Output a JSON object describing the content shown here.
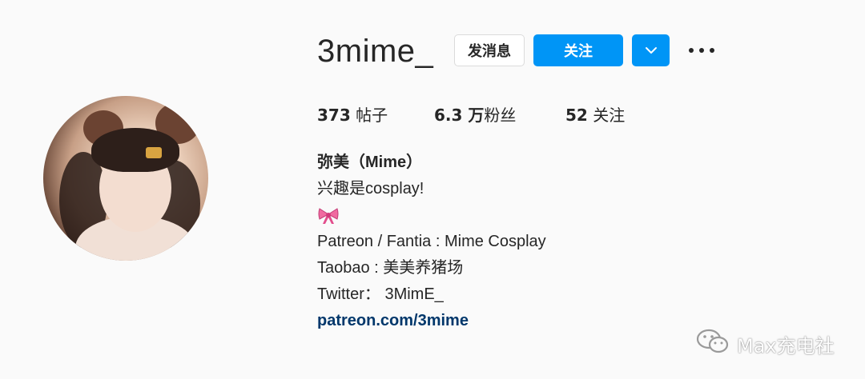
{
  "profile": {
    "username": "3mime_",
    "message_label": "发消息",
    "follow_label": "关注",
    "more_icon": "more-horizontal-icon",
    "dropdown_icon": "chevron-down-icon"
  },
  "stats": {
    "posts_num": "373",
    "posts_label": " 帖子",
    "followers_num": "6.3 万",
    "followers_label": "粉丝",
    "following_num": "52",
    "following_label": " 关注"
  },
  "bio": {
    "display_name": "弥美（Mime）",
    "line1": "兴趣是cosplay!",
    "emoji": "ribbon-emoji",
    "line2": "Patreon / Fantia : Mime Cosplay",
    "line3": "Taobao : 美美养猪场",
    "line4": "Twitter： 3MimE_",
    "link": "patreon.com/3mime"
  },
  "watermark": {
    "text": "Max充电社",
    "icon": "wechat-icon"
  },
  "colors": {
    "accent": "#0095f6",
    "link": "#00376b",
    "text": "#262626",
    "background": "#fafafa"
  }
}
